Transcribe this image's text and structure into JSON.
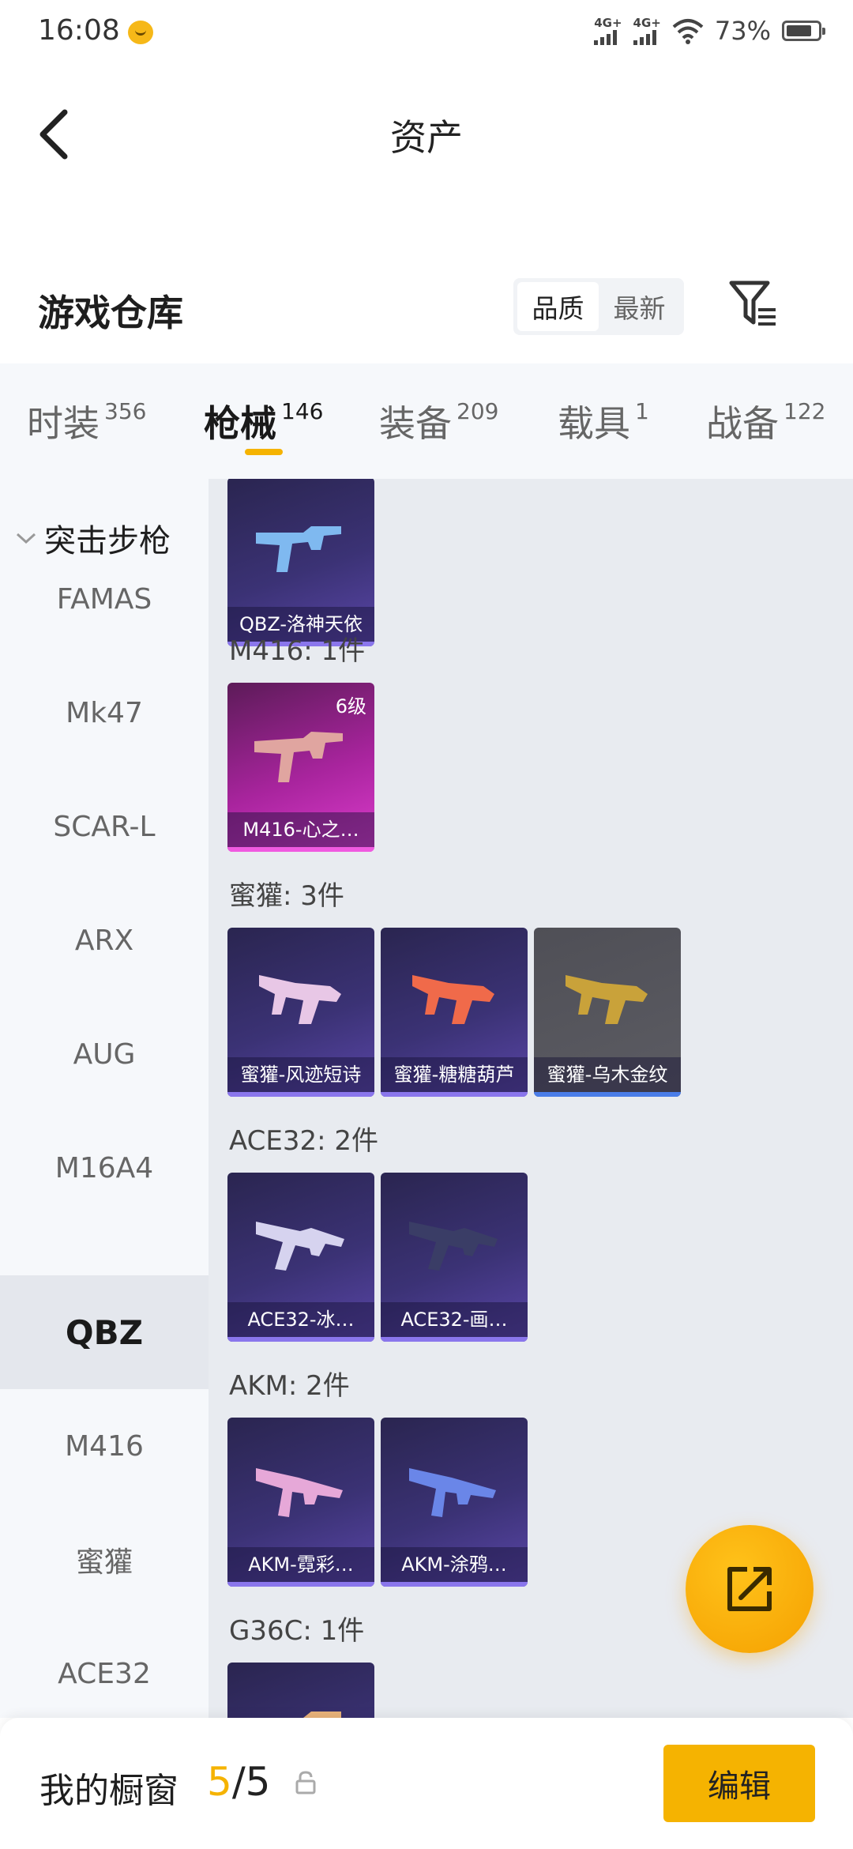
{
  "status": {
    "time": "16:08",
    "net1": "4G+",
    "net2": "4G+",
    "battery": "73%"
  },
  "header": {
    "title": "资产"
  },
  "warehouse": {
    "title": "游戏仓库",
    "sort_quality": "品质",
    "sort_newest": "最新"
  },
  "tabs": [
    {
      "label": "时装",
      "count": "356"
    },
    {
      "label": "枪械",
      "count": "146"
    },
    {
      "label": "装备",
      "count": "209"
    },
    {
      "label": "载具",
      "count": "1"
    },
    {
      "label": "战备",
      "count": "122"
    }
  ],
  "sidebar": {
    "group": "突击步枪",
    "items": [
      "FAMAS",
      "Mk47",
      "SCAR-L",
      "ARX",
      "AUG",
      "M16A4",
      "QBZ",
      "M416",
      "蜜獾",
      "ACE32"
    ],
    "active": "QBZ"
  },
  "content": {
    "prev_card": {
      "label": "QBZ-洛神天依"
    },
    "groups": [
      {
        "title": "M416: 1件",
        "items": [
          {
            "label": "M416-心之…",
            "level": "6级"
          }
        ]
      },
      {
        "title": "蜜獾: 3件",
        "items": [
          {
            "label": "蜜獾-风迹短诗"
          },
          {
            "label": "蜜獾-糖糖葫芦"
          },
          {
            "label": "蜜獾-乌木金纹"
          }
        ]
      },
      {
        "title": "ACE32: 2件",
        "items": [
          {
            "label": "ACE32-冰…"
          },
          {
            "label": "ACE32-画…"
          }
        ]
      },
      {
        "title": "AKM: 2件",
        "items": [
          {
            "label": "AKM-霓彩…"
          },
          {
            "label": "AKM-涂鸦…"
          }
        ]
      },
      {
        "title": "G36C: 1件",
        "items": []
      }
    ]
  },
  "bottom": {
    "showcase_label": "我的橱窗",
    "showcase_current": "5",
    "showcase_sep_total": "/5",
    "edit_label": "编辑"
  },
  "colors": {
    "accent": "#f5b301",
    "card_purple": "#3b3275",
    "card_pink": "#a8249d",
    "card_grey": "#5c5c63"
  }
}
